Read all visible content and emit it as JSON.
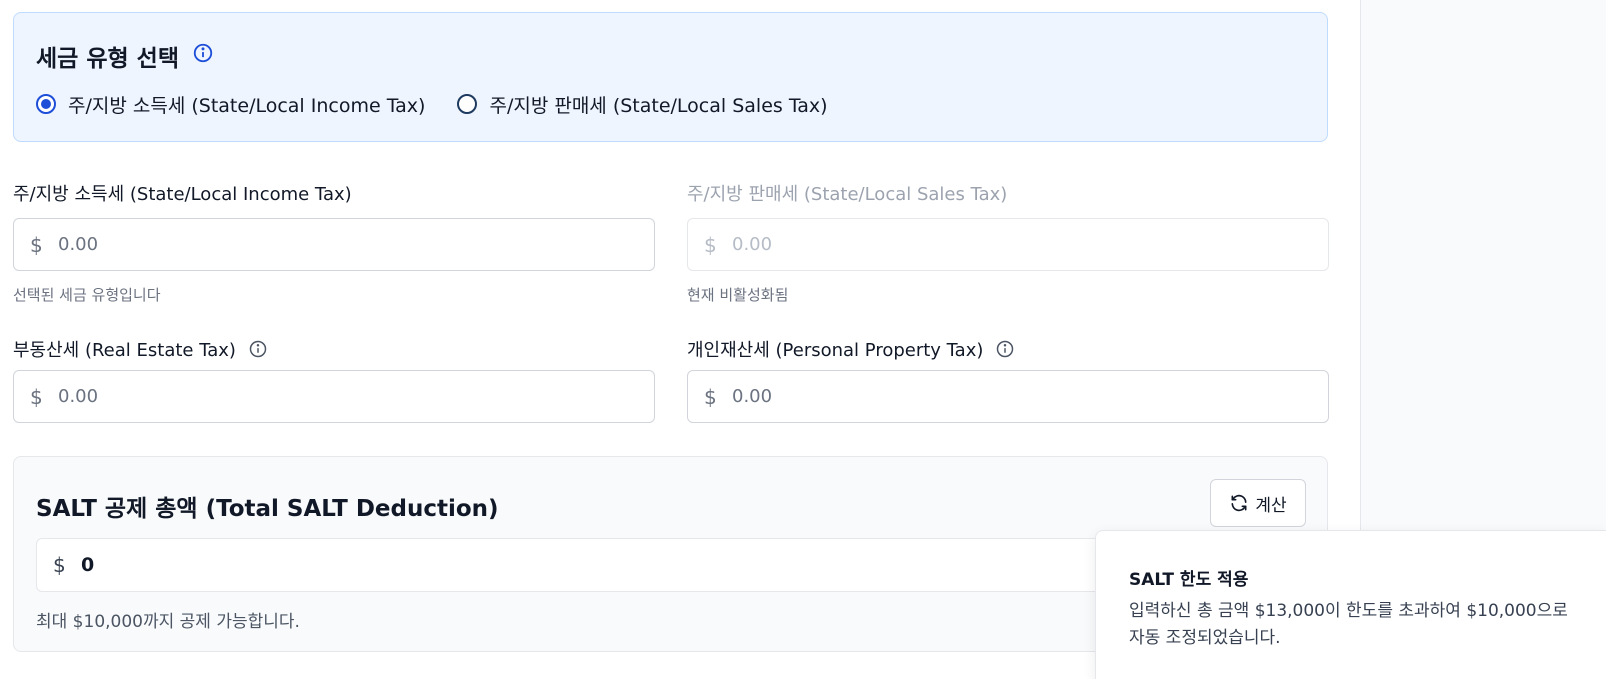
{
  "tax_type": {
    "title": "세금 유형 선택",
    "options": [
      {
        "label": "주/지방 소득세 (State/Local Income Tax)",
        "selected": true
      },
      {
        "label": "주/지방 판매세 (State/Local Sales Tax)",
        "selected": false
      }
    ]
  },
  "income_tax": {
    "label": "주/지방 소득세 (State/Local Income Tax)",
    "currency": "$",
    "placeholder": "0.00",
    "helper": "선택된 세금 유형입니다"
  },
  "sales_tax": {
    "label": "주/지방 판매세 (State/Local Sales Tax)",
    "currency": "$",
    "placeholder": "0.00",
    "helper": "현재 비활성화됨"
  },
  "real_estate_tax": {
    "label": "부동산세 (Real Estate Tax)",
    "currency": "$",
    "placeholder": "0.00"
  },
  "personal_property_tax": {
    "label": "개인재산세 (Personal Property Tax)",
    "currency": "$",
    "placeholder": "0.00"
  },
  "total": {
    "title": "SALT 공제 총액 (Total SALT Deduction)",
    "calc_button_label": "계산",
    "currency": "$",
    "value": "0",
    "helper": "최대 $10,000까지 공제 가능합니다."
  },
  "toast": {
    "title": "SALT 한도 적용",
    "body": "입력하신 총 금액 $13,000이 한도를 초과하여 $10,000으로 자동 조정되었습니다."
  },
  "colors": {
    "accent": "#1d4ed8",
    "selection_bg": "#eef5ff",
    "selection_border": "#bfdbfe"
  },
  "icons": {
    "tax_type_info": "info-circle-icon",
    "calc_button": "refresh-icon"
  }
}
